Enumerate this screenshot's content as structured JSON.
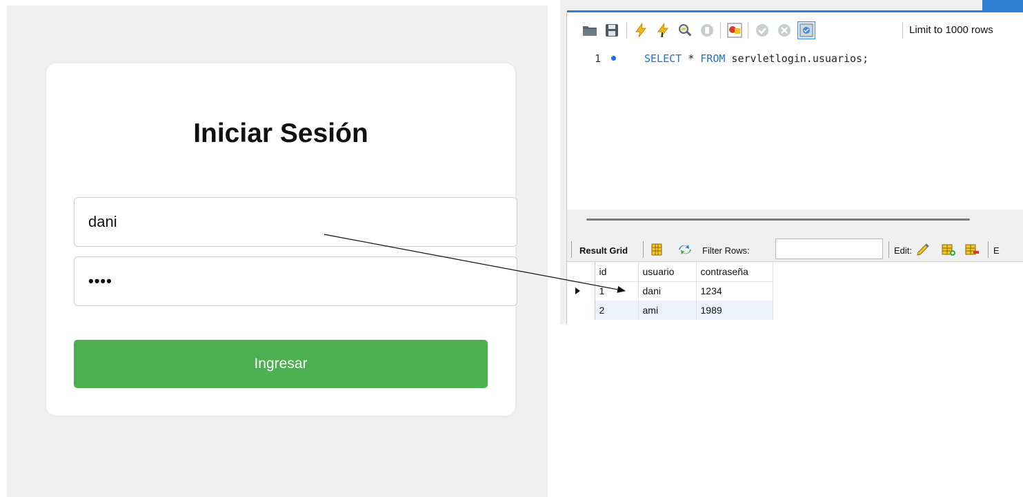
{
  "login": {
    "title": "Iniciar Sesión",
    "username_value": "dani",
    "password_value": "••••",
    "submit_label": "Ingresar",
    "accent_color": "#4caf50"
  },
  "workbench": {
    "toolbar": {
      "icons": [
        "open-folder-icon",
        "save-icon",
        "execute-lightning-icon",
        "execute-cursor-lightning-icon",
        "explain-magnifier-icon",
        "stop-icon",
        "toggle-error-stop-icon",
        "commit-icon",
        "rollback-icon",
        "autocommit-toggle-icon"
      ],
      "limit_label": "Limit to 1000 rows"
    },
    "editor": {
      "line_number": "1",
      "code": {
        "kw_select": "SELECT",
        "star": " * ",
        "kw_from": "FROM",
        "rest": " servletlogin.usuarios;"
      }
    },
    "result_bar": {
      "result_grid_label": "Result Grid",
      "filter_label": "Filter Rows:",
      "filter_value": "",
      "edit_label": "Edit:",
      "trailing_label": "E"
    },
    "grid": {
      "columns": [
        "id",
        "usuario",
        "contraseña"
      ],
      "rows": [
        {
          "id": "1",
          "usuario": "dani",
          "pass": "1234"
        },
        {
          "id": "2",
          "usuario": "ami",
          "pass": "1989"
        }
      ]
    }
  }
}
